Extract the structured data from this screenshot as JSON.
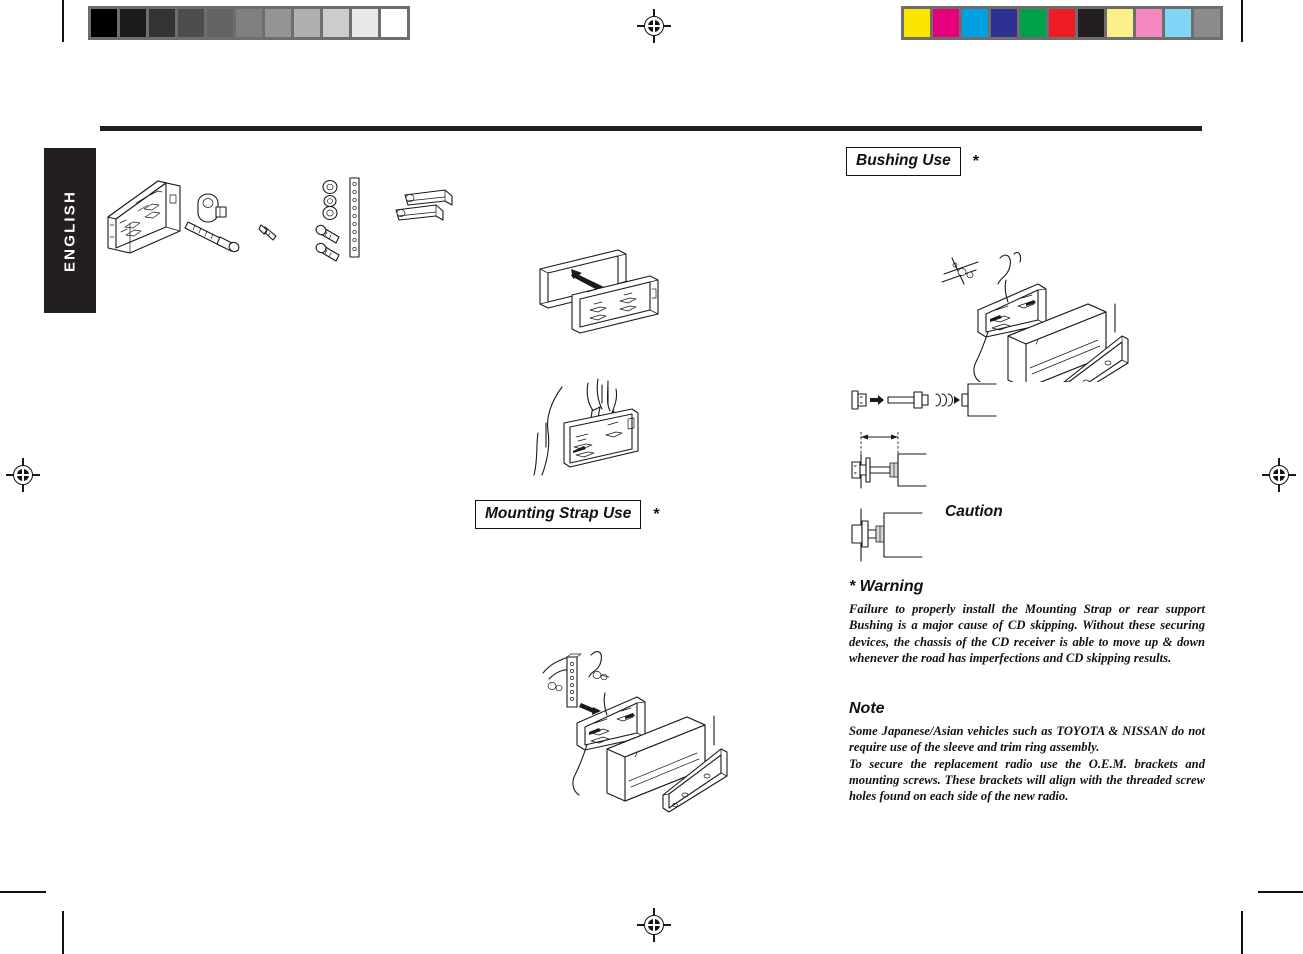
{
  "page": {
    "language_tab": "ENGLISH"
  },
  "calibration": {
    "gray_bar_name": "grayscale-calibration-bar",
    "gray_swatches": [
      "#000000",
      "#1c1c1c",
      "#333333",
      "#4d4d4d",
      "#636363",
      "#808080",
      "#949494",
      "#b0b0b0",
      "#cccccc",
      "#e8e8e8",
      "#ffffff"
    ],
    "color_bar_name": "color-calibration-bar",
    "color_swatches": [
      "#fbe500",
      "#e6007e",
      "#00a0e3",
      "#2e3192",
      "#00a14b",
      "#ed1c24",
      "#231f20",
      "#fbef8a",
      "#f489c0",
      "#80d4f4",
      "#8c8c8c"
    ]
  },
  "sections": {
    "bushing": {
      "title": "Bushing Use",
      "star": "*"
    },
    "mounting_strap": {
      "title": "Mounting Strap Use",
      "star": "*"
    },
    "caution": {
      "label": "Caution"
    }
  },
  "warning": {
    "heading": "* Warning",
    "body": "Failure to properly install the Mounting Strap or rear support Bushing is a major cause of CD skipping. Without these securing devices, the chassis of the CD receiver is able to move up & down whenever the road has imperfections and CD skipping results."
  },
  "note": {
    "heading": "Note",
    "body_1": "Some Japanese/Asian vehicles such as TOYOTA & NISSAN do not require use of the sleeve and trim ring assembly.",
    "body_2": "To secure the replacement radio use the O.E.M. brackets and mounting screws. These brackets will align with the threaded screw holes found on each side of the new radio."
  },
  "illustrations": {
    "parts_kit": "parts-kit-illustration",
    "trim_ring_sleeve": "trim-ring-and-sleeve-illustration",
    "dash_insert": "dash-insert-illustration",
    "mounting_strap_assembly": "mounting-strap-assembly-illustration",
    "bushing_assembly": "bushing-assembly-illustration",
    "bushing_detail_exploded": "bushing-exploded-detail",
    "bushing_detail_long": "bushing-long-screw-detail",
    "bushing_detail_short": "bushing-short-screw-detail"
  },
  "colors": {
    "ink": "#1a1a1a",
    "tab_bg": "#231f20",
    "tab_text": "#ffffff"
  }
}
